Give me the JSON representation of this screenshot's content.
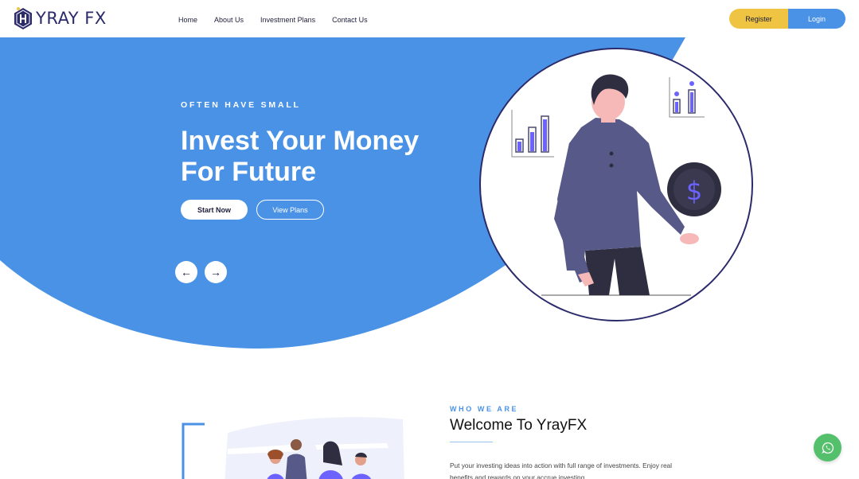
{
  "brand": {
    "name": "YRAY FX",
    "logo_letter": "H"
  },
  "nav": {
    "items": [
      "Home",
      "About Us",
      "Investment Plans",
      "Contact Us"
    ]
  },
  "auth": {
    "register_label": "Register",
    "login_label": "Login"
  },
  "hero": {
    "eyebrow": "OFTEN HAVE SMALL",
    "headline": "Invest Your Money For Future",
    "start_label": "Start Now",
    "plans_label": "View Plans",
    "prev_arrow": "←",
    "next_arrow": "→",
    "coin_symbol": "$"
  },
  "about": {
    "eyebrow": "WHO WE ARE",
    "title": "Welcome To YrayFX",
    "body": "Put your investing ideas into action with full range of investments. Enjoy real benefits and rewards on your accrue investing."
  },
  "colors": {
    "hero_blue": "#4a92e6",
    "register_yellow": "#f0c443",
    "brand_navy": "#2b2a6b",
    "whatsapp_green": "#54c06b"
  },
  "icons": [
    "logo-hexagon-icon",
    "arrow-left-icon",
    "arrow-right-icon",
    "dollar-coin-icon",
    "bar-chart-icon",
    "whatsapp-icon"
  ]
}
